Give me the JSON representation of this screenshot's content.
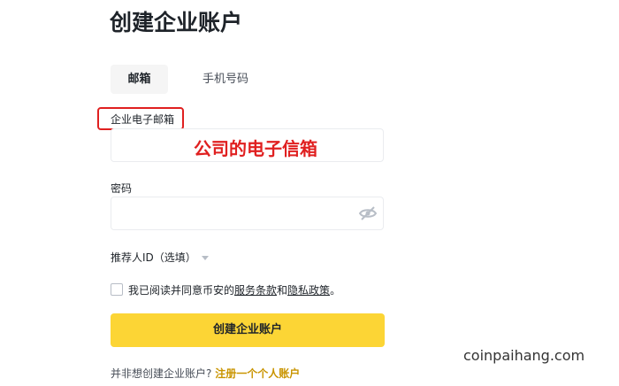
{
  "page": {
    "title": "创建企业账户"
  },
  "tabs": [
    {
      "label": "邮箱",
      "active": true
    },
    {
      "label": "手机号码",
      "active": false
    }
  ],
  "email": {
    "label": "企业电子邮箱",
    "value": "",
    "annotation": "公司的电子信箱"
  },
  "password": {
    "label": "密码",
    "value": "",
    "toggle_icon": "eye-off-icon"
  },
  "referral": {
    "label": "推荐人ID（选填）",
    "icon": "caret-down-icon"
  },
  "agreement": {
    "prefix": "我已阅读并同意币安的",
    "terms_link": "服务条款",
    "and": "和",
    "privacy_link": "隐私政策",
    "suffix": "。",
    "checked": false
  },
  "submit": {
    "label": "创建企业账户",
    "color": "#fcd535"
  },
  "footer": {
    "question": "并非想创建企业账户?",
    "link": "注册一个个人账户",
    "link_color": "#c99400"
  },
  "watermark": "coinpaihang.com",
  "colors": {
    "annotation": "#e02020"
  }
}
